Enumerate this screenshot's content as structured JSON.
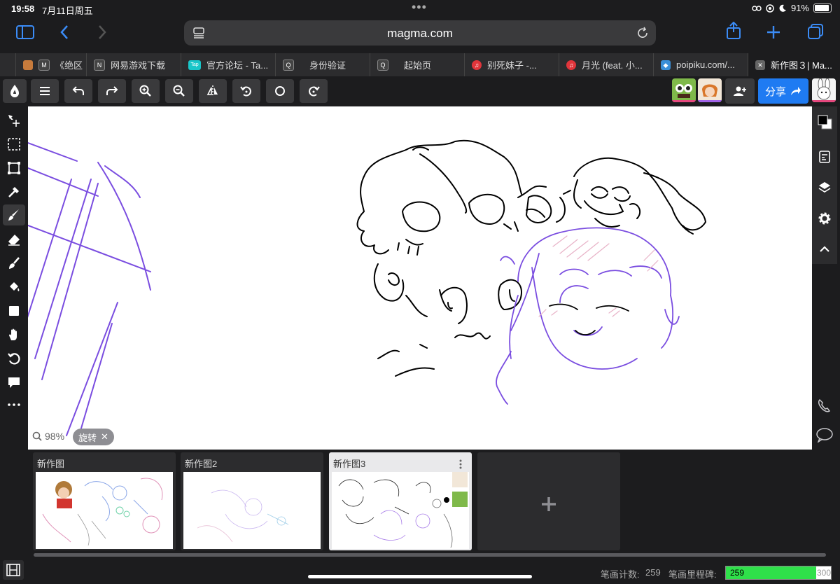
{
  "status": {
    "time": "19:58",
    "date": "7月11日周五",
    "battery_text": "91%",
    "battery_level": 0.91
  },
  "browser": {
    "url": "magma.com"
  },
  "tabs": [
    {
      "label": "《绝区",
      "icon": "avatar-favicon",
      "color": "#c77b3c",
      "glyph": ""
    },
    {
      "label": "网易游戏下载",
      "icon": "n-favicon",
      "color": "#444",
      "glyph": "N"
    },
    {
      "label": "官方论坛 - Ta...",
      "icon": "taptap-favicon",
      "color": "#19c6c9",
      "glyph": "Tap"
    },
    {
      "label": "身份验证",
      "icon": "q-favicon",
      "color": "#444",
      "glyph": "Q"
    },
    {
      "label": "起始页",
      "icon": "q-favicon",
      "color": "#444",
      "glyph": "Q"
    },
    {
      "label": "别死妹子 -...",
      "icon": "netease-music-favicon",
      "color": "#e0353b",
      "glyph": "♫"
    },
    {
      "label": "月光 (feat. 小...",
      "icon": "netease-music-favicon",
      "color": "#e0353b",
      "glyph": "♫"
    },
    {
      "label": "poipiku.com/...",
      "icon": "poipiku-favicon",
      "color": "#3a8fd8",
      "glyph": "◆"
    },
    {
      "label": "新作图３| Ma...",
      "icon": "close-icon",
      "color": "#666",
      "glyph": "✕"
    }
  ],
  "tab_leading_label": "M",
  "app": {
    "share_label": "分享"
  },
  "canvas": {
    "zoom": "98%",
    "rotate_label": "旋转"
  },
  "documents": [
    {
      "title": "新作图"
    },
    {
      "title": "新作图2"
    },
    {
      "title": "新作图3"
    }
  ],
  "footer": {
    "stroke_count_label": "笔画计数:",
    "stroke_count": "259",
    "milestone_label": "笔画里程碑:",
    "milestone_value": "259",
    "milestone_max": "300",
    "milestone_fraction": 0.863
  },
  "colors": {
    "accent": "#1f7bf2",
    "progress": "#2fe04a",
    "nav": "#3b8cf7"
  }
}
